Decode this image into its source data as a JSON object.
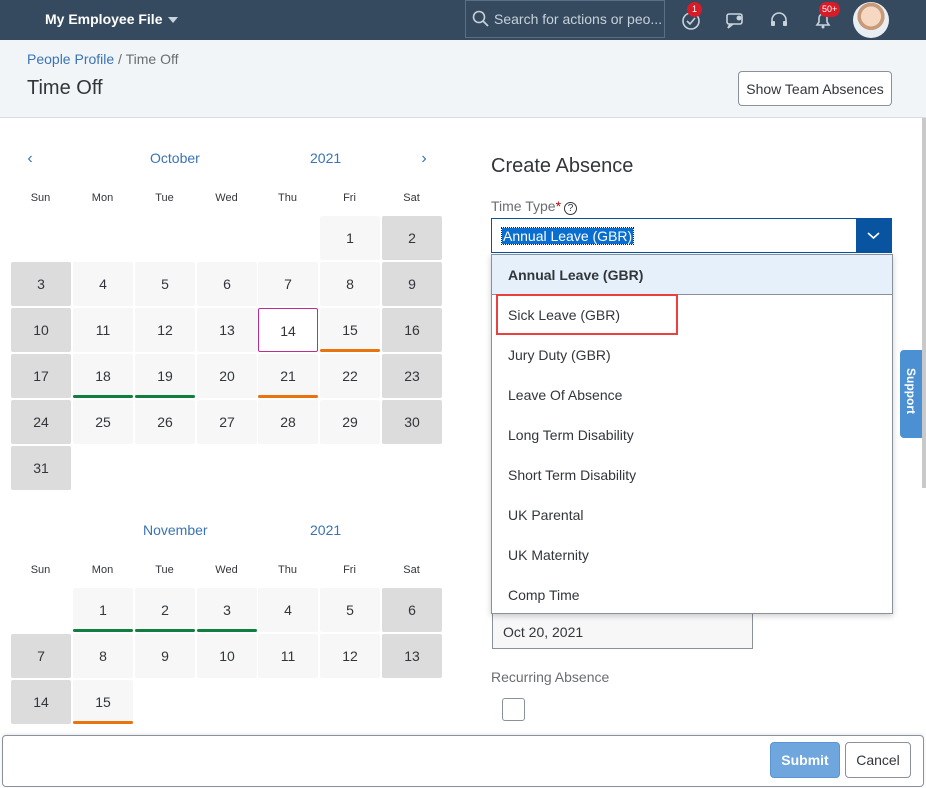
{
  "shell": {
    "app_title": "My Employee File",
    "search_placeholder": "Search for actions or peo...",
    "todo_badge": "1",
    "notifications_badge": "50+"
  },
  "header": {
    "breadcrumb_link": "People Profile",
    "breadcrumb_sep": " / ",
    "breadcrumb_current": "Time Off",
    "page_title": "Time Off",
    "team_button": "Show Team Absences"
  },
  "calendar": {
    "weekdays": [
      "Sun",
      "Mon",
      "Tue",
      "Wed",
      "Thu",
      "Fri",
      "Sat"
    ],
    "marker_colors": {
      "green": "#107e3e",
      "orange": "#e9730c"
    },
    "months": [
      {
        "month": "October",
        "year": "2021",
        "first_weekday": 5,
        "days": 31,
        "today": 14,
        "markers": {
          "15": "orange",
          "18": "green",
          "19": "green",
          "21": "orange"
        }
      },
      {
        "month": "November",
        "year": "2021",
        "first_weekday": 1,
        "days": 15,
        "today": null,
        "markers": {
          "1": "green",
          "2": "green",
          "3": "green",
          "15": "orange"
        }
      }
    ]
  },
  "form": {
    "title": "Create Absence",
    "time_type_label": "Time Type",
    "required_mark": "*",
    "help_glyph": "?",
    "selected_value": "Annual Leave (GBR)",
    "options": [
      "Annual Leave (GBR)",
      "Sick Leave (GBR)",
      "Jury Duty (GBR)",
      "Leave Of Absence",
      "Long Term Disability",
      "Short Term Disability",
      "UK Parental",
      "UK Maternity",
      "Comp Time"
    ],
    "end_date_value": "Oct 20, 2021",
    "recurring_label": "Recurring Absence"
  },
  "support_tab": "Support",
  "footer": {
    "submit": "Submit",
    "cancel": "Cancel"
  }
}
